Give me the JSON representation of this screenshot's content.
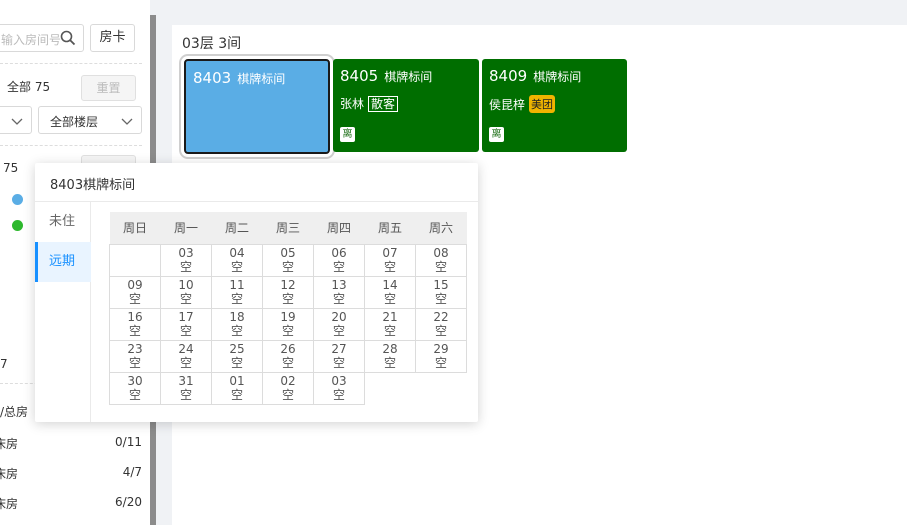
{
  "sidebar": {
    "search_placeholder": "输入房间号",
    "card_button": "房卡",
    "all_label": "全部 75",
    "reset_button": "重置",
    "floor_select": "全部楼层",
    "count": "75",
    "num": "7",
    "stat_header": "/总房",
    "stats": [
      {
        "name": "床房",
        "count": "0/11"
      },
      {
        "name": "床房",
        "count": "4/7"
      },
      {
        "name": "床房",
        "count": "6/20"
      }
    ],
    "dot_colors": [
      "#5aade5",
      "#2db82d"
    ]
  },
  "main": {
    "floor_title": "03层 3间",
    "rooms": [
      {
        "no": "8403",
        "type": "棋牌标间",
        "guest": "",
        "tag": "",
        "badge": "",
        "color": "#5aade5"
      },
      {
        "no": "8405",
        "type": "棋牌标间",
        "guest": "张林",
        "tag": "散客",
        "badge": "离",
        "color": "#006e00"
      },
      {
        "no": "8409",
        "type": "棋牌标间",
        "guest": "侯昆梓",
        "tag": "美团",
        "badge": "离",
        "color": "#006e00"
      }
    ]
  },
  "popover": {
    "title": "8403棋牌标间",
    "tabs": [
      "未住",
      "远期"
    ],
    "active_tab": "远期",
    "weekdays": [
      "周日",
      "周一",
      "周二",
      "周三",
      "周四",
      "周五",
      "周六"
    ],
    "weeks": [
      [
        null,
        {
          "d": "03",
          "s": "空"
        },
        {
          "d": "04",
          "s": "空"
        },
        {
          "d": "05",
          "s": "空"
        },
        {
          "d": "06",
          "s": "空"
        },
        {
          "d": "07",
          "s": "空"
        },
        {
          "d": "08",
          "s": "空"
        }
      ],
      [
        {
          "d": "09",
          "s": "空"
        },
        {
          "d": "10",
          "s": "空"
        },
        {
          "d": "11",
          "s": "空"
        },
        {
          "d": "12",
          "s": "空"
        },
        {
          "d": "13",
          "s": "空"
        },
        {
          "d": "14",
          "s": "空"
        },
        {
          "d": "15",
          "s": "空"
        }
      ],
      [
        {
          "d": "16",
          "s": "空"
        },
        {
          "d": "17",
          "s": "空"
        },
        {
          "d": "18",
          "s": "空"
        },
        {
          "d": "19",
          "s": "空"
        },
        {
          "d": "20",
          "s": "空"
        },
        {
          "d": "21",
          "s": "空"
        },
        {
          "d": "22",
          "s": "空"
        }
      ],
      [
        {
          "d": "23",
          "s": "空"
        },
        {
          "d": "24",
          "s": "空"
        },
        {
          "d": "25",
          "s": "空"
        },
        {
          "d": "26",
          "s": "空"
        },
        {
          "d": "27",
          "s": "空"
        },
        {
          "d": "28",
          "s": "空"
        },
        {
          "d": "29",
          "s": "空"
        }
      ],
      [
        {
          "d": "30",
          "s": "空"
        },
        {
          "d": "31",
          "s": "空"
        },
        {
          "d": "01",
          "s": "空"
        },
        {
          "d": "02",
          "s": "空"
        },
        {
          "d": "03",
          "s": "空"
        },
        null,
        null
      ]
    ]
  }
}
